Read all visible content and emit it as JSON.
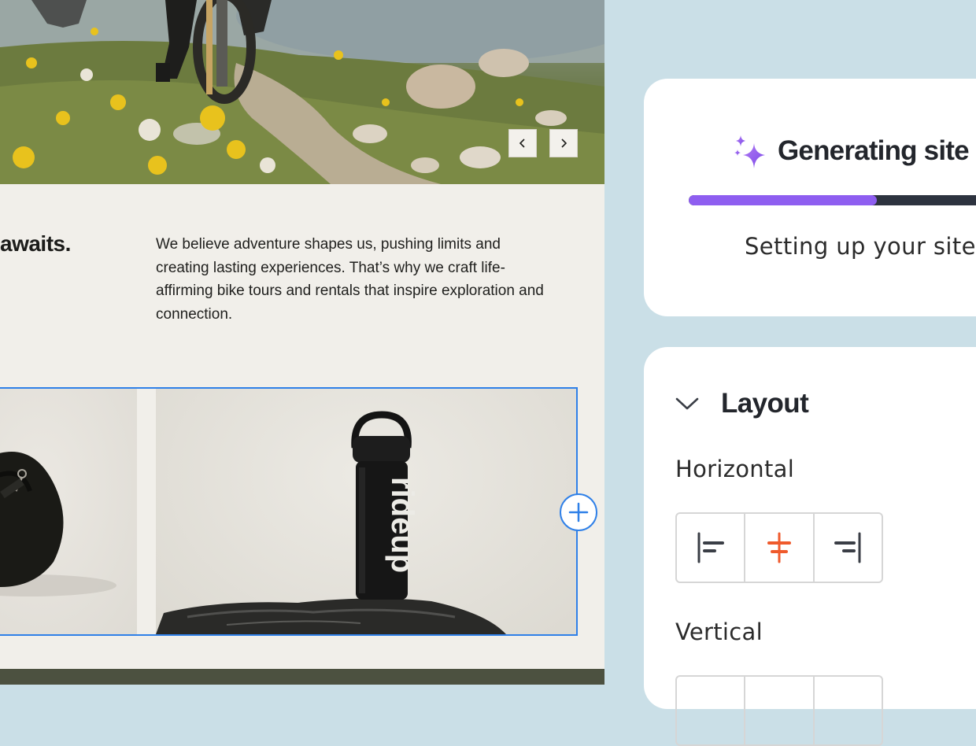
{
  "site": {
    "headline": "awaits.",
    "body": "We believe adventure shapes us, pushing limits and creating lasting experiences. That’s why we craft life-affirming bike tours and rentals that inspire exploration and connection.",
    "bottle_brand": "rideup",
    "slider_prev_icon": "chevron-left-icon",
    "slider_next_icon": "chevron-right-icon",
    "add_icon": "plus-icon"
  },
  "generating": {
    "title": "Generating site",
    "icon": "sparkles-icon",
    "status": "Setting up your site",
    "progress_fraction": 0.57,
    "progress_color": "#8e5ef0"
  },
  "layout_panel": {
    "title": "Layout",
    "expanded": true,
    "horizontal_label": "Horizontal",
    "horizontal_options": [
      "align-left-icon",
      "align-center-icon",
      "align-right-icon"
    ],
    "horizontal_selected": "align-center-icon",
    "selected_color": "#ef5a2c",
    "vertical_label": "Vertical"
  },
  "colors": {
    "selection_outline": "#2f80e8",
    "panel_background": "#cadfe7"
  }
}
